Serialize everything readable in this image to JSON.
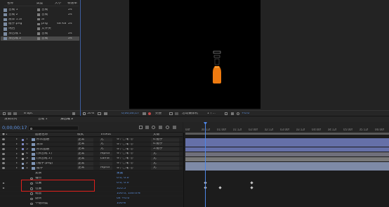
{
  "project": {
    "headers": {
      "name": "名称",
      "type": "类型",
      "size": "大小",
      "rate": "帧速率"
    },
    "items": [
      {
        "name": "合成 1",
        "type": "合成",
        "size": "",
        "rate": "24"
      },
      {
        "name": "合成 2",
        "type": "合成",
        "size": "",
        "rate": "24"
      },
      {
        "name": "液体 1.ai",
        "type": "ai",
        "size": "",
        "rate": ""
      },
      {
        "name": "瓶子.png",
        "type": "png",
        "size": "48 KB",
        "rate": "24"
      },
      {
        "name": "纯色",
        "type": "文件夹",
        "size": "",
        "rate": ""
      },
      {
        "name": "预合成 1",
        "type": "合成",
        "size": "",
        "rate": "24"
      },
      {
        "name": "预合成 2",
        "type": "合成",
        "size": "",
        "rate": "24"
      }
    ],
    "selected_index": 6,
    "footer_bpc": "8 bpc"
  },
  "viewer": {
    "zoom": "50%",
    "timecode": "0;00;00;17",
    "resolution": "完整",
    "camera": "活动摄像机",
    "views": "1个...",
    "exposure": "+0.0"
  },
  "timeline": {
    "tabs": [
      "渲染队列",
      "合成 1",
      "预合成 2"
    ],
    "active_tab": 2,
    "current_time": "0;00;00;17",
    "search_placeholder": "",
    "headers": {
      "layer_name": "图层名称",
      "mode": "模式",
      "trkmat": "TrkMat",
      "parent": "父级"
    },
    "layers": [
      {
        "num": "7",
        "name": "形状图层",
        "mode": "正常",
        "trkmat": "无",
        "parent": "6.瓶子",
        "color": "#7c86c0"
      },
      {
        "num": "6",
        "name": "液体",
        "mode": "正常",
        "trkmat": "无",
        "parent": "6.瓶子",
        "color": "#7c86c0"
      },
      {
        "num": "5",
        "name": "形状图层",
        "mode": "正常",
        "trkmat": "无",
        "parent": "5.瓶子",
        "color": "#7c86c0"
      },
      {
        "num": "4",
        "name": "[预合成 1]",
        "mode": "正常",
        "trkmat": "Alpha",
        "parent": "无",
        "color": "#9a9a9a"
      },
      {
        "num": "3",
        "name": "[预合成 2]",
        "mode": "正常",
        "trkmat": "Luma",
        "parent": "无",
        "color": "#9a9a9a"
      },
      {
        "num": "2",
        "name": "[瓶子.png]",
        "mode": "正常",
        "trkmat": "",
        "parent": "无",
        "color": "#8a9cb8"
      },
      {
        "num": "1",
        "name": "瓶子",
        "mode": "正常",
        "trkmat": "Alpha",
        "parent": "无",
        "color": "#8a9cb8"
      }
    ],
    "properties": [
      {
        "name": "变换",
        "value": "重置"
      },
      {
        "name": "锚点",
        "value": "0.0, 0.0"
      },
      {
        "name": "位置",
        "value": "0.0, 0.0"
      },
      {
        "name": "位置",
        "value": "355.5"
      },
      {
        "name": "缩放",
        "value": "100.0, 100.0%"
      },
      {
        "name": "旋转",
        "value": "0x +0.0°"
      },
      {
        "name": "不透明度",
        "value": "100%"
      }
    ],
    "ruler": [
      "00f",
      "00:12f",
      "01:00f",
      "01:12f",
      "02:00f",
      "02:12f",
      "03:00f",
      "03:12f",
      "04:00f",
      "04:12f",
      "05:00f",
      "05:12f",
      "06:00f"
    ],
    "accent": "#4d86e6",
    "highlight_color": "#e0201c"
  }
}
